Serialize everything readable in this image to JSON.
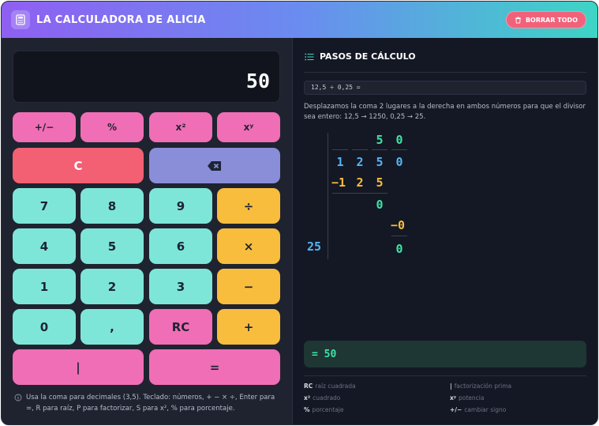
{
  "header": {
    "title": "LA CALCULADORA DE ALICIA",
    "clear_all": "BORRAR TODO",
    "colors": {
      "gradient_start": "#8f5ff2",
      "gradient_end": "#3dd5c5",
      "clear": "#f2617a"
    }
  },
  "display": {
    "value": "50"
  },
  "keys": {
    "sign": "+/−",
    "percent": "%",
    "square": "x²",
    "power": "xʸ",
    "clear": "C",
    "backspace_icon": "backspace-icon",
    "seven": "7",
    "eight": "8",
    "nine": "9",
    "divide": "÷",
    "four": "4",
    "five": "5",
    "six": "6",
    "multiply": "×",
    "one": "1",
    "two": "2",
    "three": "3",
    "minus": "−",
    "zero": "0",
    "comma": ",",
    "root": "RC",
    "plus": "+",
    "factor": "|",
    "equals": "="
  },
  "hint": "Usa la coma para decimales (3,5). Teclado: números, + − × ÷, Enter para =, R para raíz, P para factorizar, S para x², % para porcentaje.",
  "steps": {
    "title": "PASOS DE CÁLCULO",
    "expression": "12,5 ÷ 0,25 =",
    "explanation": "Desplazamos la coma 2 lugares a la derecha en ambos números para que el divisor sea entero: 12,5 → 1250, 0,25 → 25.",
    "division": {
      "divisor": "25",
      "quotient": [
        "5",
        "0"
      ],
      "dividend": [
        "1",
        "2",
        "5",
        "0"
      ],
      "sub1": [
        "−1",
        "2",
        "5"
      ],
      "rem1": "0",
      "sub2": "−0",
      "rem2": "0"
    },
    "result": "= 50"
  },
  "legend": [
    {
      "key": "RC",
      "desc": "raíz cuadrada"
    },
    {
      "key": "|",
      "desc": "factorización prima"
    },
    {
      "key": "x²",
      "desc": "cuadrado"
    },
    {
      "key": "xʸ",
      "desc": "potencia"
    },
    {
      "key": "%",
      "desc": "porcentaje"
    },
    {
      "key": "+/−",
      "desc": "cambiar signo"
    }
  ]
}
